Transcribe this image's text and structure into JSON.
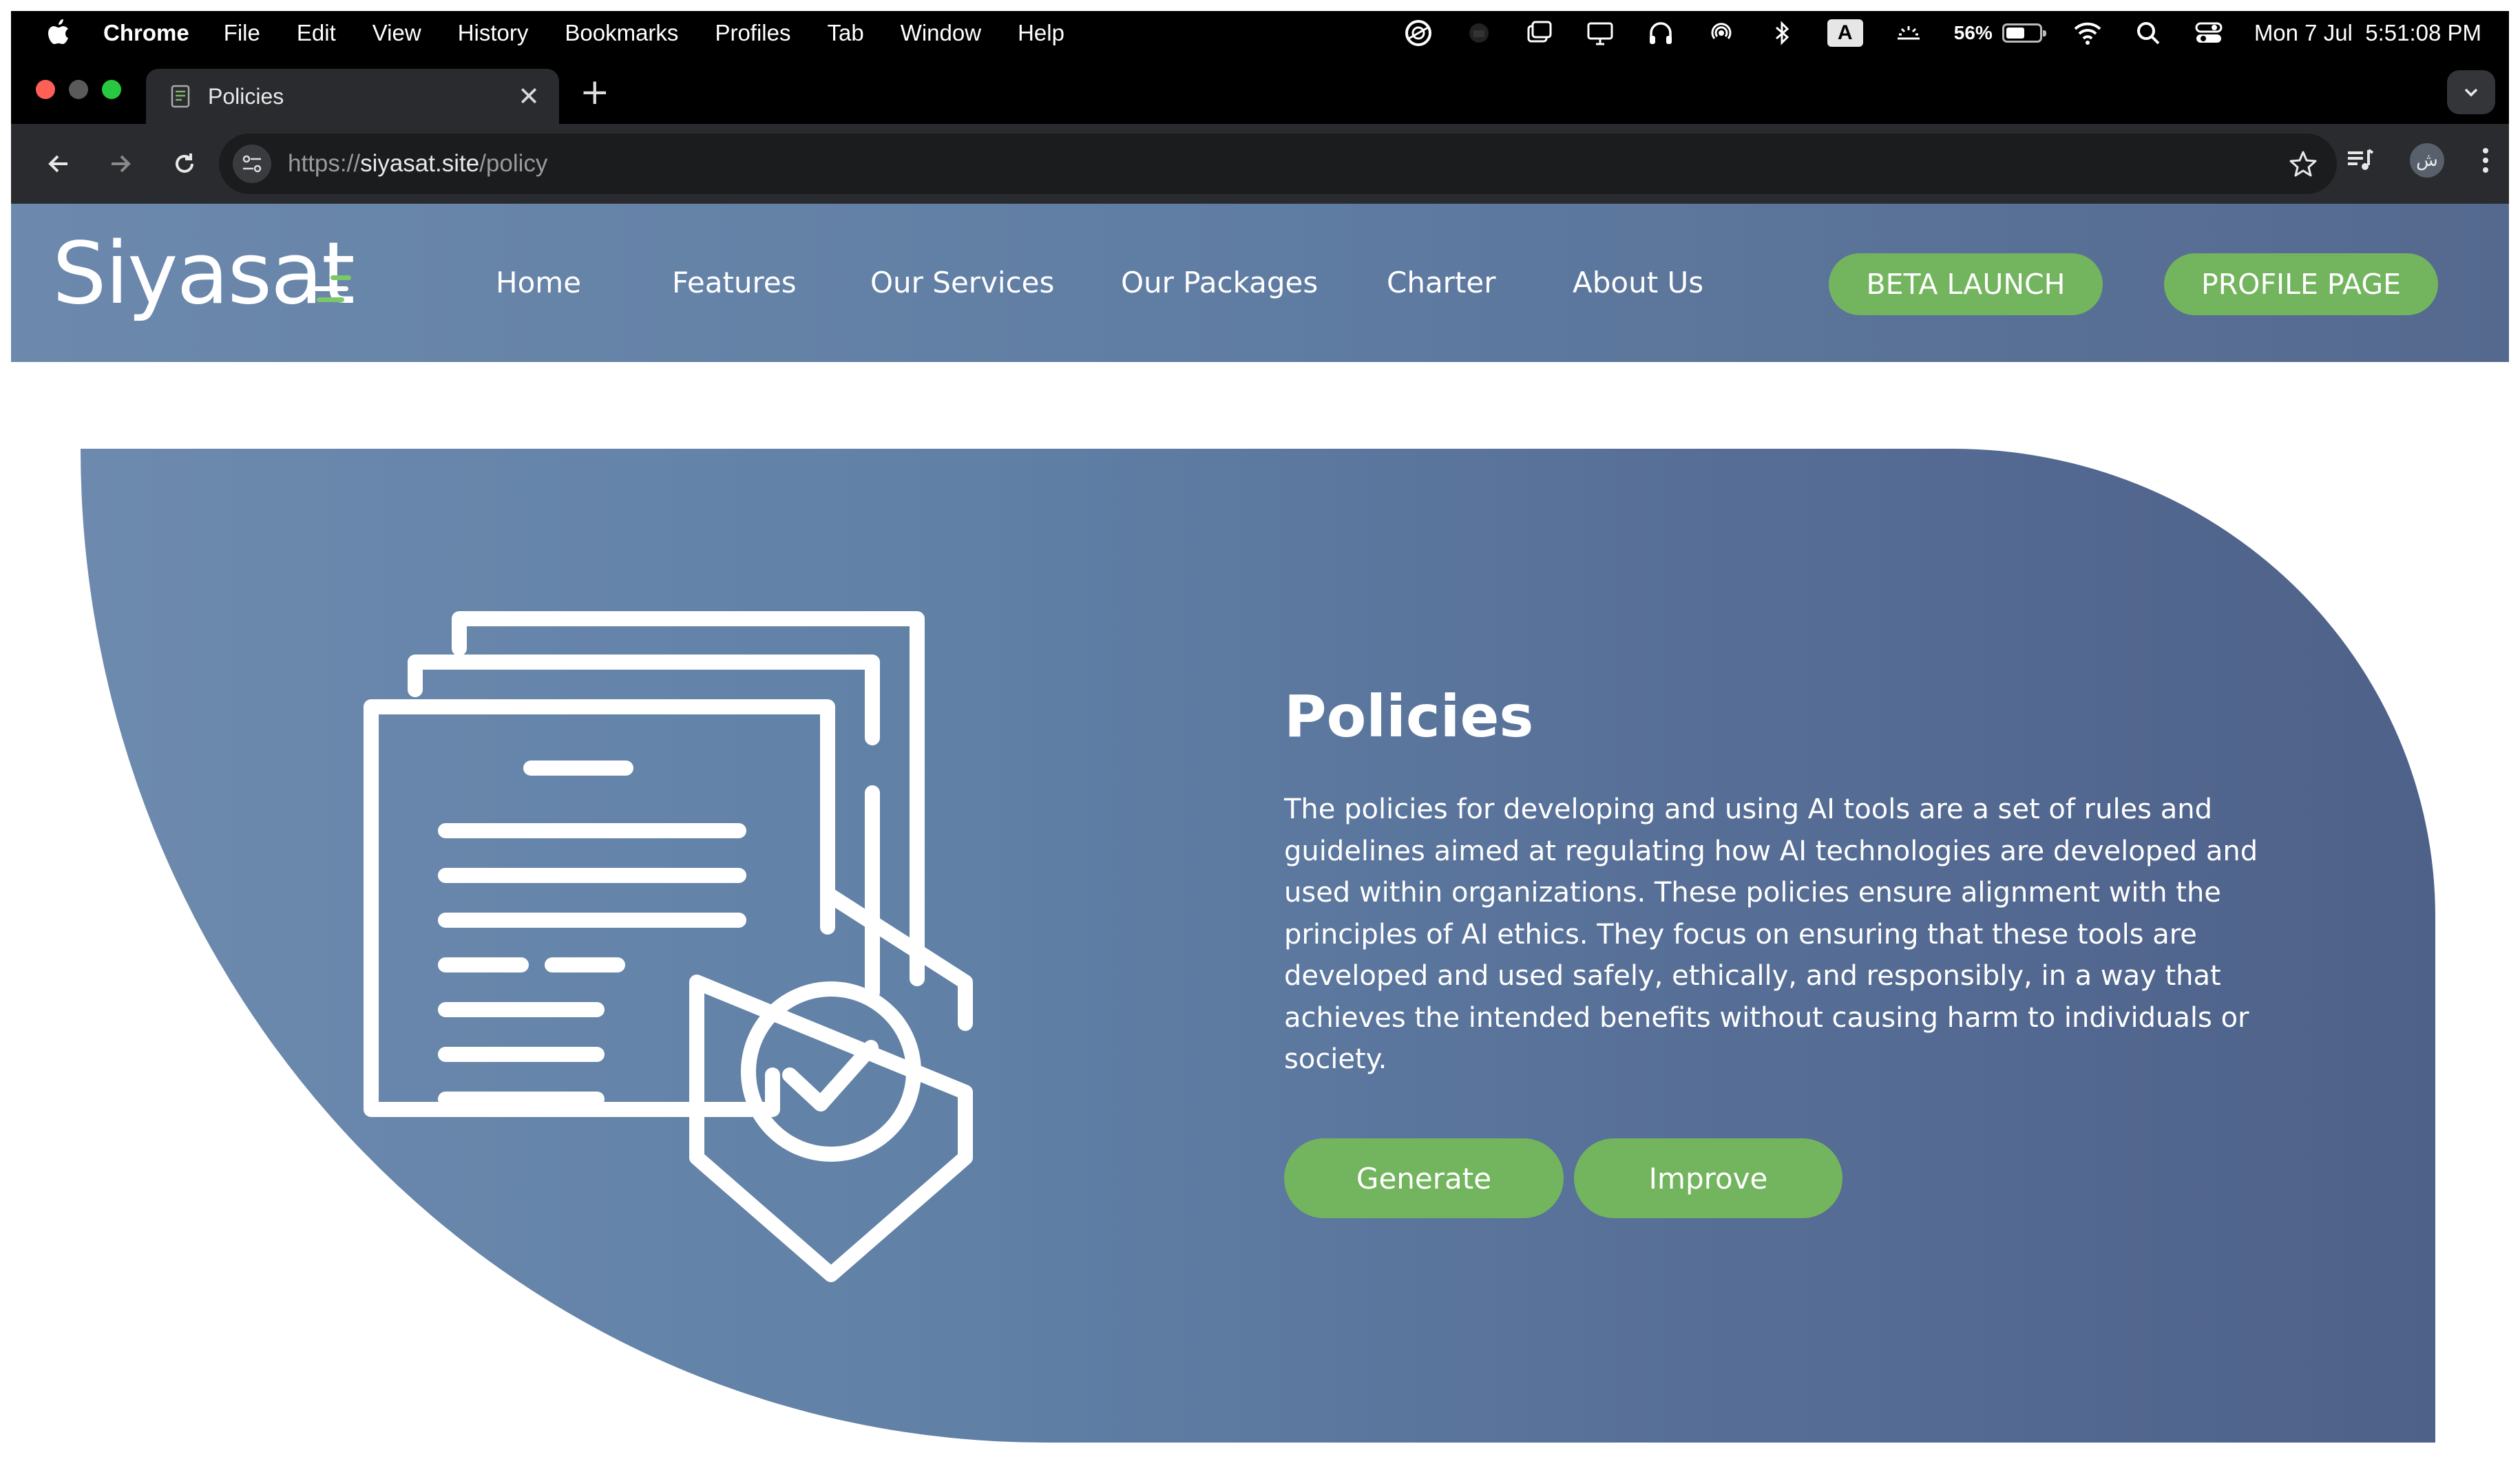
{
  "menubar": {
    "app_name": "Chrome",
    "menus": [
      "File",
      "Edit",
      "View",
      "History",
      "Bookmarks",
      "Profiles",
      "Tab",
      "Window",
      "Help"
    ],
    "keyboard_input": "A",
    "battery_percent": "56%",
    "battery_level": 0.56,
    "datetime": "Mon 7 Jul  5:51:08 PM"
  },
  "browser": {
    "tab_title": "Policies",
    "url_scheme": "https://",
    "url_host": "siyasat.site",
    "url_path": "/policy",
    "profile_initial": "ش"
  },
  "site": {
    "logo_text": "Siyasat",
    "nav": [
      "Home",
      "Features",
      "Our Services",
      "Our Packages",
      "Charter",
      "About Us"
    ],
    "beta_button": "BETA LAUNCH",
    "profile_button": "PROFILE PAGE"
  },
  "hero": {
    "title": "Policies",
    "description": "The policies for developing and using AI tools are a set of rules and guidelines aimed at regulating how AI technologies are developed and used within organizations. These policies ensure alignment with the principles of AI ethics. They focus on ensuring that these tools are developed and used safely, ethically, and responsibly, in a way that achieves the intended benefits without causing harm to individuals or society.",
    "generate_button": "Generate",
    "improve_button": "Improve"
  },
  "colors": {
    "accent_green": "#73b45e",
    "header_blue": "#6c89ad",
    "hero_blue_dark": "#4e6189"
  },
  "icons": [
    "apple-icon",
    "creative-cloud-icon",
    "screen-mirror-icon",
    "display-icon",
    "headphones-icon",
    "airdrop-icon",
    "bluetooth-icon",
    "brightness-icon",
    "wifi-icon",
    "search-icon",
    "control-center-icon",
    "document-icon",
    "close-icon",
    "back-icon",
    "forward-icon",
    "reload-icon",
    "site-settings-icon",
    "star-icon",
    "media-controls-icon",
    "more-icon",
    "policy-document-shield-icon"
  ]
}
